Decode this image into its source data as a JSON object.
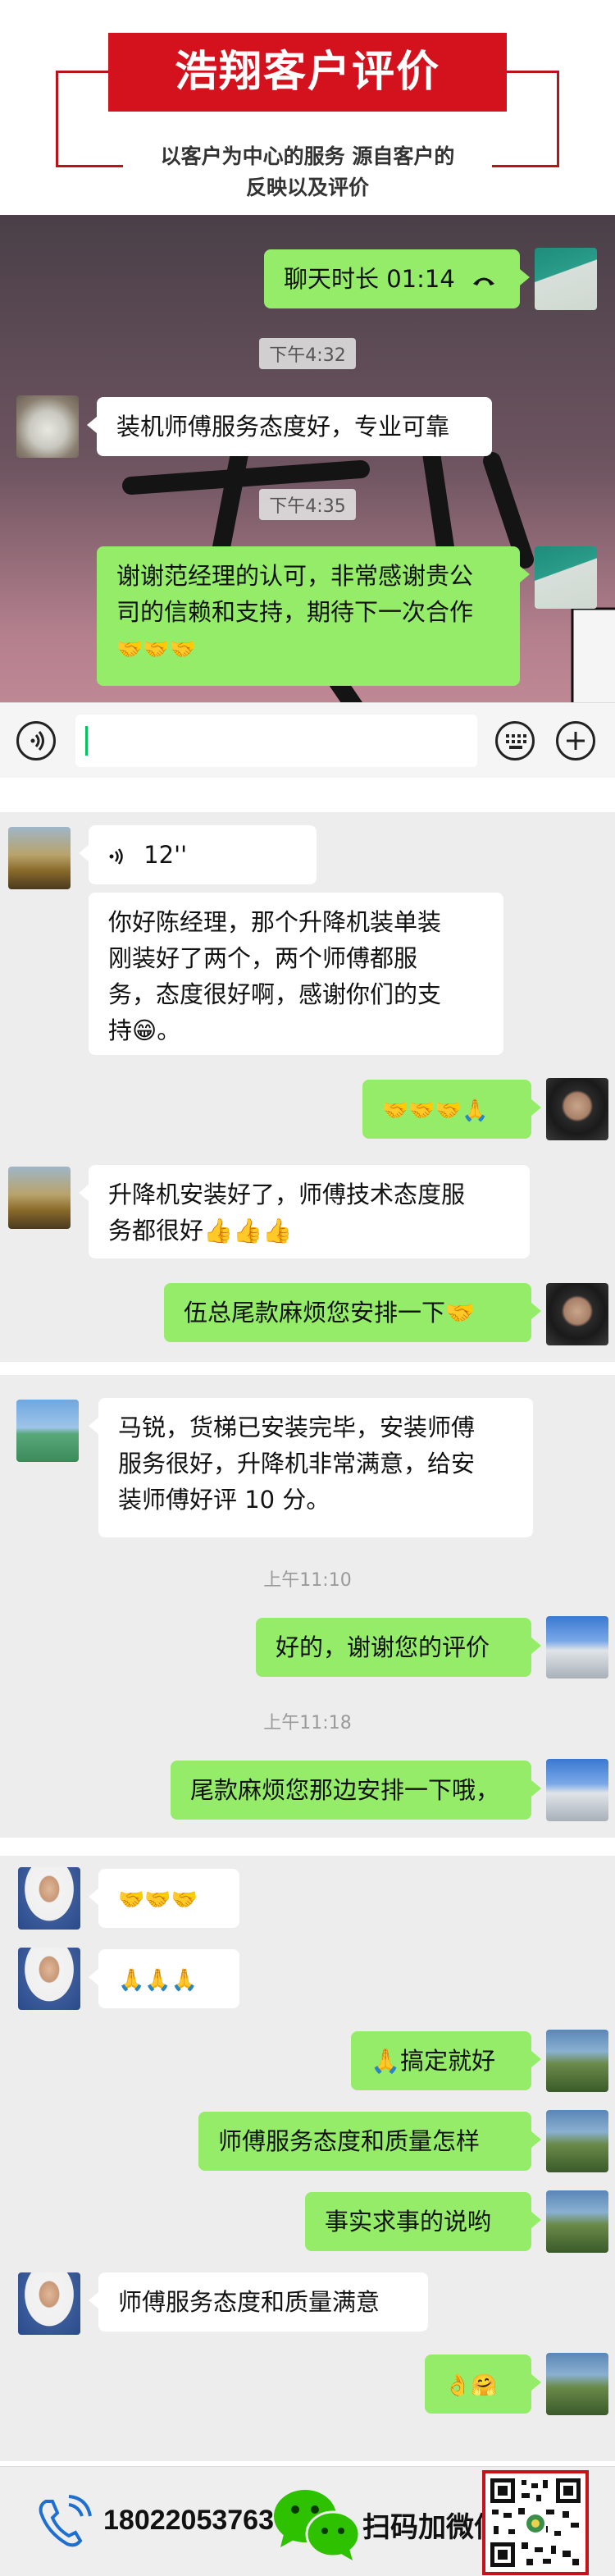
{
  "header": {
    "title": "浩翔客户评价",
    "subtitle_line1": "以客户为中心的服务 源自客户的",
    "subtitle_line2": "反映以及评价"
  },
  "chat1": {
    "call_text": "聊天时长 01:14",
    "call_icon": "phone-hangup-icon",
    "time1": "下午4:32",
    "msg1": "装机师傅服务态度好，专业可靠",
    "time2": "下午4:35",
    "msg2_line1": "谢谢范经理的认可，非常感谢贵公",
    "msg2_line2": "司的信赖和支持，期待下一次合作",
    "msg2_emoji": "🤝🤝🤝",
    "input_bar": {
      "voice_icon": "voice-icon",
      "emoji_icon": "keyboard-icon",
      "plus_icon": "plus-icon"
    }
  },
  "chat2": {
    "voice_duration": "12''",
    "msg1": [
      "你好陈经理，那个升降机装单装",
      "刚装好了两个，两个师傅都服",
      "务，态度很好啊，感谢你们的支",
      "持😁。"
    ],
    "reply1": "🤝🤝🤝🙏",
    "msg2": [
      "升降机安装好了，师傅技术态度服",
      "务都很好👍👍👍"
    ],
    "reply2": "伍总尾款麻烦您安排一下🤝"
  },
  "chat3": {
    "msg1": [
      "马锐，货梯已安装完毕，安装师傅",
      "服务很好，升降机非常满意，给安",
      "装师傅好评 10 分。"
    ],
    "time1": "上午11:10",
    "reply1": "好的，谢谢您的评价",
    "time2": "上午11:18",
    "reply2": "尾款麻烦您那边安排一下哦，"
  },
  "chat4": {
    "msg1": "🤝🤝🤝",
    "msg2": "🙏🙏🙏",
    "reply1": "🙏搞定就好",
    "reply2": "师傅服务态度和质量怎样",
    "reply3": "事实求事的说哟",
    "msg3": "师傅服务态度和质量满意",
    "reply4": "👌🤗"
  },
  "footer": {
    "phone": "18022053763",
    "wechat_label": "扫码加微信",
    "phone_icon": "phone-icon",
    "wechat_icon": "wechat-icon",
    "qr_icon": "qr-code"
  }
}
